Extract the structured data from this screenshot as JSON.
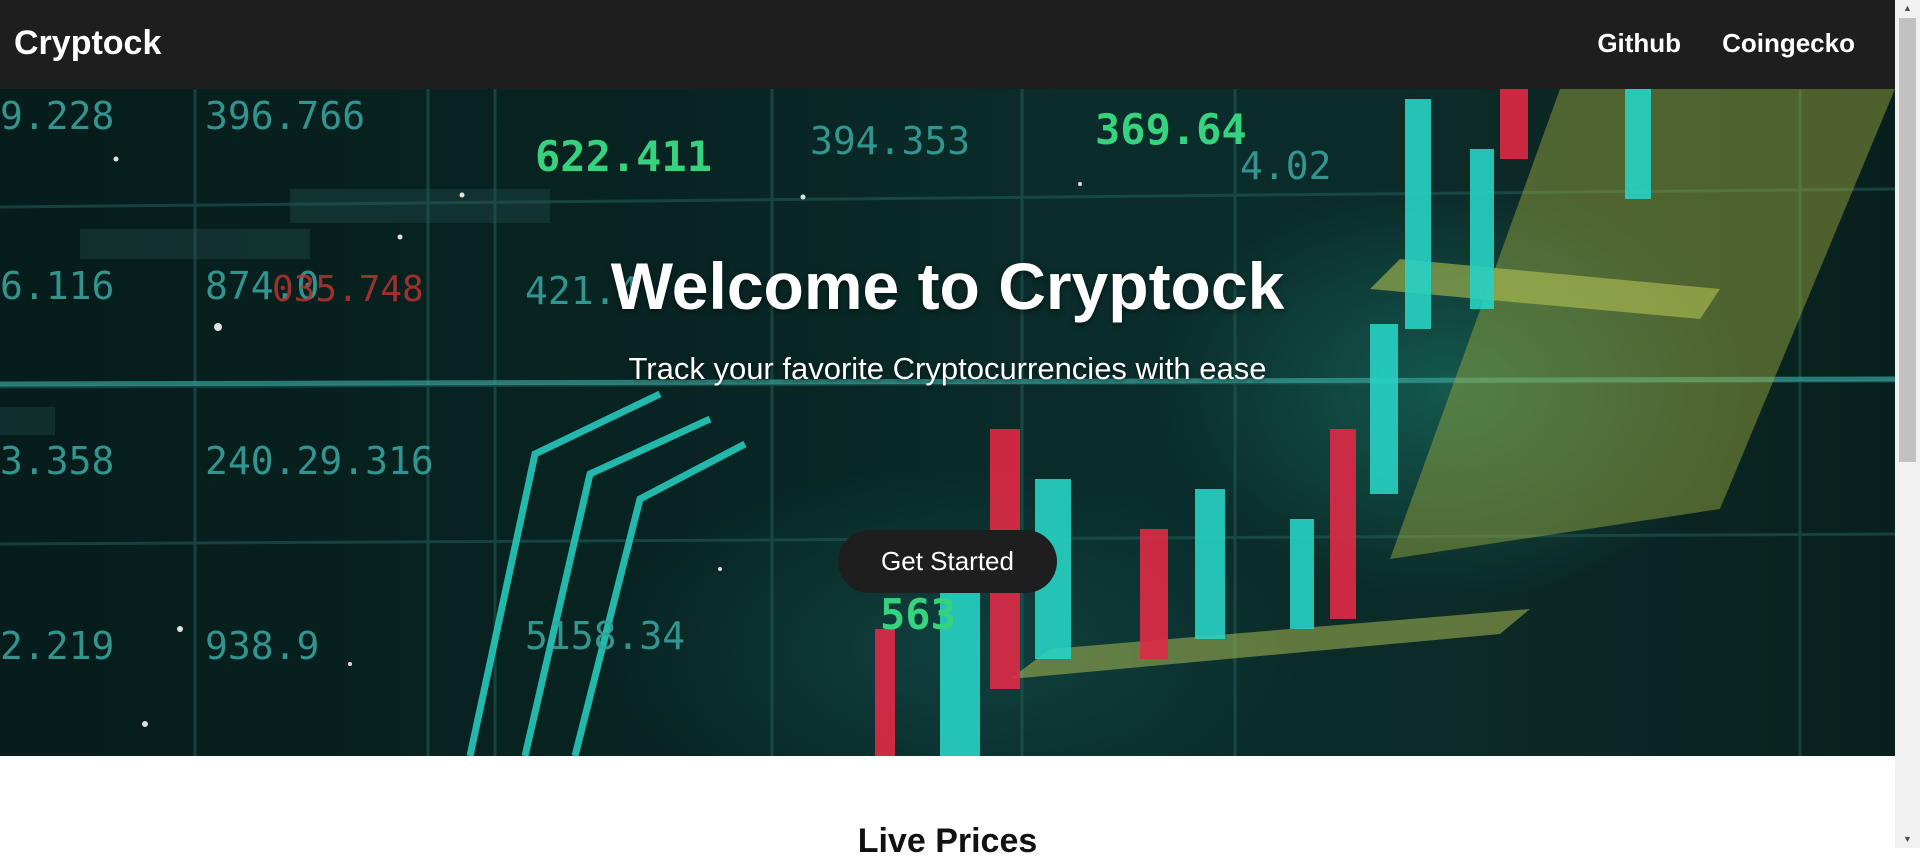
{
  "navbar": {
    "brand": "Cryptock",
    "links": [
      {
        "label": "Github"
      },
      {
        "label": "Coingecko"
      }
    ]
  },
  "hero": {
    "title": "Welcome to Cryptock",
    "subtitle": "Track your favorite Cryptocurrencies with ease",
    "cta_label": "Get Started"
  },
  "live_prices": {
    "title": "Live Prices"
  },
  "colors": {
    "nav_background": "#1e1e1e",
    "button_background": "#1e1e1e",
    "hero_accent_teal": "#2ef0e0",
    "hero_accent_red": "#ff3050",
    "hero_accent_yellow": "#d8e860"
  }
}
